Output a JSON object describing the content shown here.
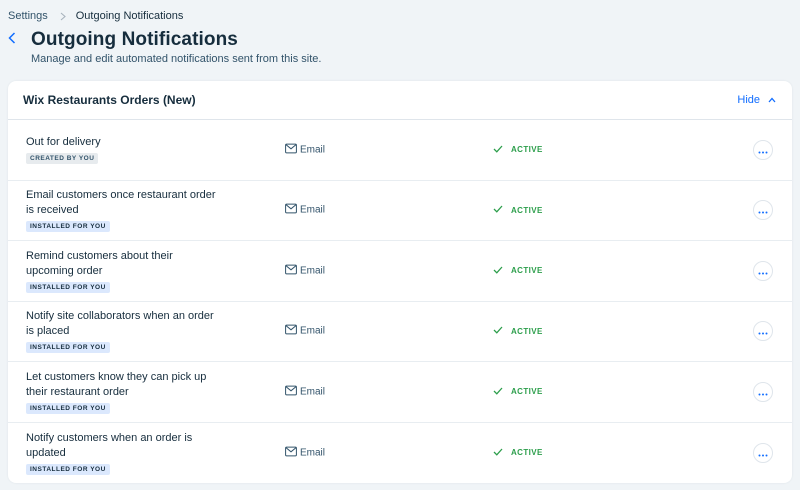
{
  "breadcrumb": {
    "parent": "Settings",
    "current": "Outgoing Notifications"
  },
  "header": {
    "title": "Outgoing Notifications",
    "subtitle": "Manage and edit automated notifications sent from this site."
  },
  "section": {
    "title": "Wix Restaurants Orders (New)",
    "toggle_label": "Hide"
  },
  "colors": {
    "accent": "#116dff",
    "active": "#2c9e4b",
    "badge_installed_bg": "#dbe8fd",
    "badge_created_bg": "#e7ebee"
  },
  "notifications": [
    {
      "name_lines": [
        "Out for delivery"
      ],
      "badge": "CREATED BY YOU",
      "badge_type": "created",
      "channel": "Email",
      "status": "ACTIVE"
    },
    {
      "name_lines": [
        "Email customers once restaurant order",
        "is received"
      ],
      "badge": "INSTALLED FOR YOU",
      "badge_type": "installed",
      "channel": "Email",
      "status": "ACTIVE"
    },
    {
      "name_lines": [
        "Remind customers about their",
        "upcoming order"
      ],
      "badge": "INSTALLED FOR YOU",
      "badge_type": "installed",
      "channel": "Email",
      "status": "ACTIVE"
    },
    {
      "name_lines": [
        "Notify site collaborators when an order",
        "is placed"
      ],
      "badge": "INSTALLED FOR YOU",
      "badge_type": "installed",
      "channel": "Email",
      "status": "ACTIVE"
    },
    {
      "name_lines": [
        "Let customers know they can pick up",
        "their restaurant order"
      ],
      "badge": "INSTALLED FOR YOU",
      "badge_type": "installed",
      "channel": "Email",
      "status": "ACTIVE"
    },
    {
      "name_lines": [
        "Notify customers when an order is",
        "updated"
      ],
      "badge": "INSTALLED FOR YOU",
      "badge_type": "installed",
      "channel": "Email",
      "status": "ACTIVE"
    }
  ]
}
